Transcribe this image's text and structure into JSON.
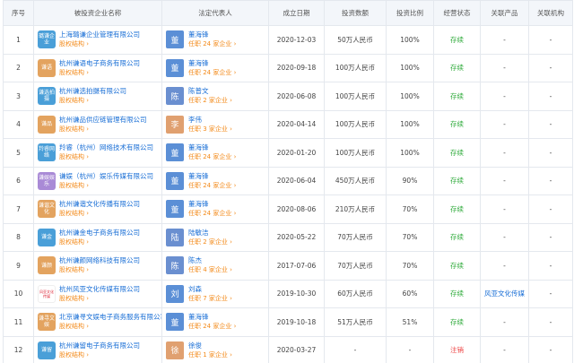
{
  "headers": [
    "序号",
    "被投资企业名称",
    "法定代表人",
    "成立日期",
    "投资数额",
    "投资比例",
    "经营状态",
    "关联产品",
    "关联机构"
  ],
  "colors": {
    "link": "#1a6fd6",
    "sub": "#f38b1c",
    "ok": "#2eaa3a",
    "bad": "#e44444"
  },
  "rows": [
    {
      "no": "1",
      "logo": "璐谦企业",
      "logo_color": "#4a9fd8",
      "company": "上海璐谦企业管理有限公司",
      "sub": "股权结构 ›",
      "avatar": "董",
      "avatar_color": "#5b8fd6",
      "rep": "董海锋",
      "rep_sub": "任职 24 家企业 ›",
      "date": "2020-12-03",
      "amount": "50万人民币",
      "ratio": "100%",
      "status": "存续",
      "status_type": "ok",
      "product": "-",
      "org": "-"
    },
    {
      "no": "2",
      "logo": "谦语",
      "logo_color": "#e3a35f",
      "company": "杭州谦语电子商务有限公司",
      "sub": "股权结构 ›",
      "avatar": "董",
      "avatar_color": "#5b8fd6",
      "rep": "董海锋",
      "rep_sub": "任职 24 家企业 ›",
      "date": "2020-09-18",
      "amount": "100万人民币",
      "ratio": "100%",
      "status": "存续",
      "status_type": "ok",
      "product": "-",
      "org": "-"
    },
    {
      "no": "3",
      "logo": "谦选拍摄",
      "logo_color": "#4a9fd8",
      "company": "杭州谦选拍摄有限公司",
      "sub": "股权结构 ›",
      "avatar": "陈",
      "avatar_color": "#6a8fd0",
      "rep": "陈普文",
      "rep_sub": "任职 2 家企业 ›",
      "date": "2020-06-08",
      "amount": "100万人民币",
      "ratio": "100%",
      "status": "存续",
      "status_type": "ok",
      "product": "-",
      "org": "-"
    },
    {
      "no": "4",
      "logo": "谦品",
      "logo_color": "#e3a35f",
      "company": "杭州谦品供应链管理有限公司",
      "sub": "股权结构 ›",
      "avatar": "李",
      "avatar_color": "#e0a070",
      "rep": "李伟",
      "rep_sub": "任职 3 家企业 ›",
      "date": "2020-04-14",
      "amount": "100万人民币",
      "ratio": "100%",
      "status": "存续",
      "status_type": "ok",
      "product": "-",
      "org": "-"
    },
    {
      "no": "5",
      "logo": "羚睿网络",
      "logo_color": "#4a9fd8",
      "company": "羚睿（杭州）网络技术有限公司",
      "sub": "股权结构 ›",
      "avatar": "董",
      "avatar_color": "#5b8fd6",
      "rep": "董海锋",
      "rep_sub": "任职 24 家企业 ›",
      "date": "2020-01-20",
      "amount": "100万人民币",
      "ratio": "100%",
      "status": "存续",
      "status_type": "ok",
      "product": "-",
      "org": "-"
    },
    {
      "no": "6",
      "logo": "谦娱娱乐",
      "logo_color": "#a98ad6",
      "company": "谦娱（杭州）娱乐传媒有限公司",
      "sub": "股权结构 ›",
      "avatar": "董",
      "avatar_color": "#5b8fd6",
      "rep": "董海锋",
      "rep_sub": "任职 24 家企业 ›",
      "date": "2020-06-04",
      "amount": "450万人民币",
      "ratio": "90%",
      "status": "存续",
      "status_type": "ok",
      "product": "-",
      "org": "-"
    },
    {
      "no": "7",
      "logo": "谦谐文化",
      "logo_color": "#e3a35f",
      "company": "杭州谦谐文化传播有限公司",
      "sub": "股权结构 ›",
      "avatar": "董",
      "avatar_color": "#5b8fd6",
      "rep": "董海锋",
      "rep_sub": "任职 24 家企业 ›",
      "date": "2020-08-06",
      "amount": "210万人民币",
      "ratio": "70%",
      "status": "存续",
      "status_type": "ok",
      "product": "-",
      "org": "-"
    },
    {
      "no": "8",
      "logo": "谦金",
      "logo_color": "#4a9fd8",
      "company": "杭州谦金电子商务有限公司",
      "sub": "股权结构 ›",
      "avatar": "陆",
      "avatar_color": "#6a8fd0",
      "rep": "陆敏洁",
      "rep_sub": "任职 2 家企业 ›",
      "date": "2020-05-22",
      "amount": "70万人民币",
      "ratio": "70%",
      "status": "存续",
      "status_type": "ok",
      "product": "-",
      "org": "-"
    },
    {
      "no": "9",
      "logo": "谦颜",
      "logo_color": "#e3a35f",
      "company": "杭州谦颜网络科技有限公司",
      "sub": "股权结构 ›",
      "avatar": "陈",
      "avatar_color": "#6a8fd0",
      "rep": "陈杰",
      "rep_sub": "任职 4 家企业 ›",
      "date": "2017-07-06",
      "amount": "70万人民币",
      "ratio": "70%",
      "status": "存续",
      "status_type": "ok",
      "product": "-",
      "org": "-"
    },
    {
      "no": "10",
      "logo": "风亚文化传媒",
      "logo_color": "img",
      "company": "杭州风亚文化传媒有限公司",
      "sub": "股权结构 ›",
      "avatar": "刘",
      "avatar_color": "#5b8fd6",
      "rep": "刘森",
      "rep_sub": "任职 7 家企业 ›",
      "date": "2019-10-30",
      "amount": "60万人民币",
      "ratio": "60%",
      "status": "存续",
      "status_type": "ok",
      "product": "风亚文化传媒",
      "org": "-"
    },
    {
      "no": "11",
      "logo": "谦寻文娱",
      "logo_color": "#e3a35f",
      "company": "北京谦寻文娱电子商务服务有限公司",
      "sub": "股权结构 ›",
      "avatar": "董",
      "avatar_color": "#5b8fd6",
      "rep": "董海锋",
      "rep_sub": "任职 24 家企业 ›",
      "date": "2019-10-18",
      "amount": "51万人民币",
      "ratio": "51%",
      "status": "存续",
      "status_type": "ok",
      "product": "-",
      "org": "-"
    },
    {
      "no": "12",
      "logo": "谦留",
      "logo_color": "#4a9fd8",
      "company": "杭州谦留电子商务有限公司",
      "sub": "股权结构 ›",
      "avatar": "徐",
      "avatar_color": "#e0a070",
      "rep": "徐俊",
      "rep_sub": "任职 1 家企业 ›",
      "date": "2020-03-27",
      "amount": "-",
      "ratio": "-",
      "status": "注销",
      "status_type": "bad",
      "product": "-",
      "org": "-"
    }
  ]
}
